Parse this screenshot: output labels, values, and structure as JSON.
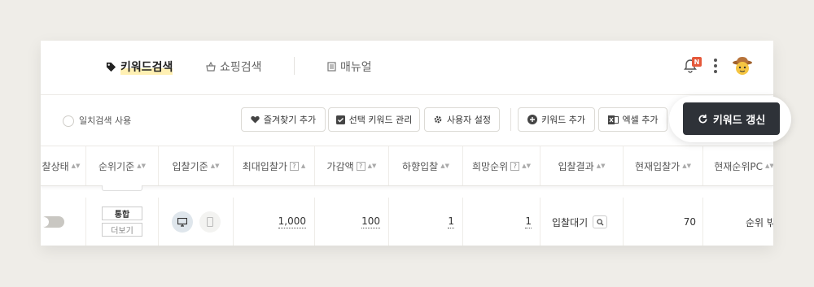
{
  "header": {
    "tabs": [
      {
        "label": "키워드검색",
        "icon": "tag-icon",
        "active": true
      },
      {
        "label": "쇼핑검색",
        "icon": "basket-icon",
        "active": false
      },
      {
        "label": "매뉴얼",
        "icon": "document-icon",
        "active": false
      }
    ],
    "notification_badge": "N"
  },
  "toolbar": {
    "exact_match_label": "일치검색 사용",
    "favorite_add": "즐겨찾기 추가",
    "manage_selected_keywords": "선택 키워드 관리",
    "user_settings": "사용자 설정",
    "add_keyword": "키워드 추가",
    "add_excel": "엑셀 추가",
    "refresh_keywords": "키워드 갱신"
  },
  "table": {
    "columns": [
      "찰상태",
      "순위기준",
      "입찰기준",
      "최대입찰가",
      "가감액",
      "하향입찰",
      "희망순위",
      "입찰결과",
      "현재입찰가",
      "현재순위PC"
    ],
    "help_mark": "?",
    "row": {
      "rank_basis_primary": "통합",
      "rank_basis_more": "더보기",
      "max_bid": "1,000",
      "adjustment": "100",
      "downward_bid": "1",
      "desired_rank": "1",
      "bid_result": "입찰대기",
      "current_bid": "70",
      "current_rank_pc": "순위 밖"
    }
  },
  "colors": {
    "page_bg": "#efede8",
    "primary_button": "#2e3238",
    "badge": "#e5583a",
    "highlight": "#fff0b3"
  }
}
